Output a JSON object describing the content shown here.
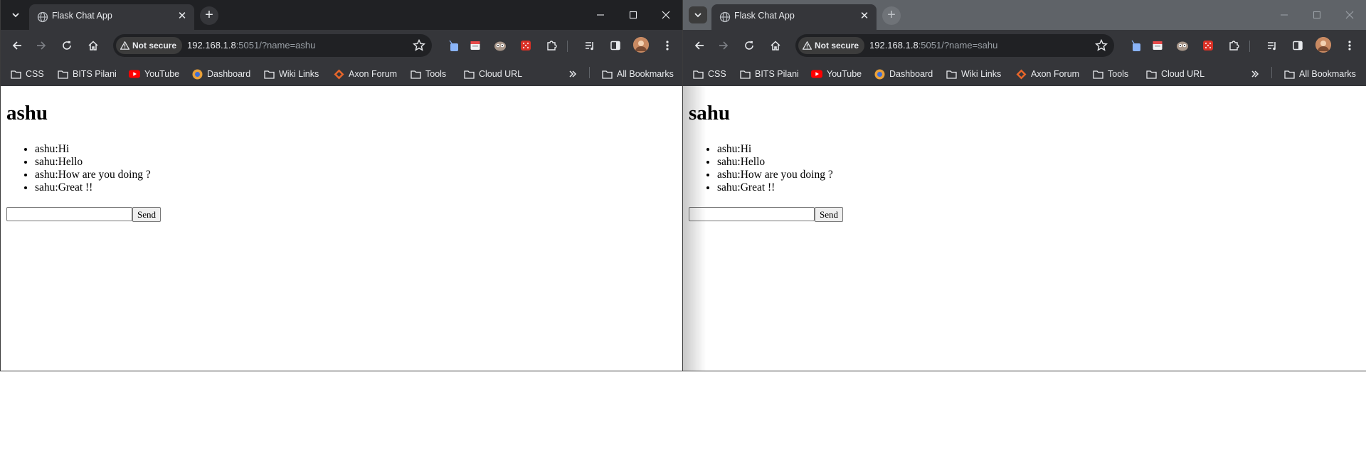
{
  "windows": [
    {
      "tab": {
        "title": "Flask Chat App"
      },
      "address": {
        "security_label": "Not secure",
        "host": "192.168.1.8",
        "rest": ":5051/?name=ashu"
      },
      "bookmarks": [
        "CSS",
        "BITS Pilani",
        "YouTube",
        "Dashboard",
        "Wiki Links",
        "Axon Forum",
        "Tools",
        "Cloud URL"
      ],
      "all_bookmarks": "All Bookmarks",
      "page": {
        "heading": "ashu",
        "messages": [
          "ashu:Hi",
          "sahu:Hello",
          "ashu:How are you doing ?",
          "sahu:Great !!"
        ],
        "input_value": "",
        "send_label": "Send"
      }
    },
    {
      "tab": {
        "title": "Flask Chat App"
      },
      "address": {
        "security_label": "Not secure",
        "host": "192.168.1.8",
        "rest": ":5051/?name=sahu"
      },
      "bookmarks": [
        "CSS",
        "BITS Pilani",
        "YouTube",
        "Dashboard",
        "Wiki Links",
        "Axon Forum",
        "Tools",
        "Cloud URL"
      ],
      "all_bookmarks": "All Bookmarks",
      "page": {
        "heading": "sahu",
        "messages": [
          "ashu:Hi",
          "sahu:Hello",
          "ashu:How are you doing ?",
          "sahu:Great !!"
        ],
        "input_value": "",
        "send_label": "Send"
      }
    }
  ],
  "icons": {
    "tab_search": "chevron-down-icon",
    "favicon": "globe-icon",
    "tab_close": "close-icon",
    "new_tab": "plus-icon",
    "back": "back-arrow-icon",
    "forward": "forward-arrow-icon",
    "reload": "reload-icon",
    "home": "home-icon",
    "warning": "warning-icon",
    "bookmark_star": "star-icon",
    "folder": "folder-icon",
    "overflow": "double-chevron-icon",
    "menu": "kebab-menu-icon"
  },
  "colors": {
    "titlebar_active": "#202124",
    "titlebar_inactive": "#5f6368",
    "toolbar": "#35363a",
    "omnibox": "#202124",
    "youtube_red": "#ff0000",
    "page_bg": "#ffffff"
  }
}
